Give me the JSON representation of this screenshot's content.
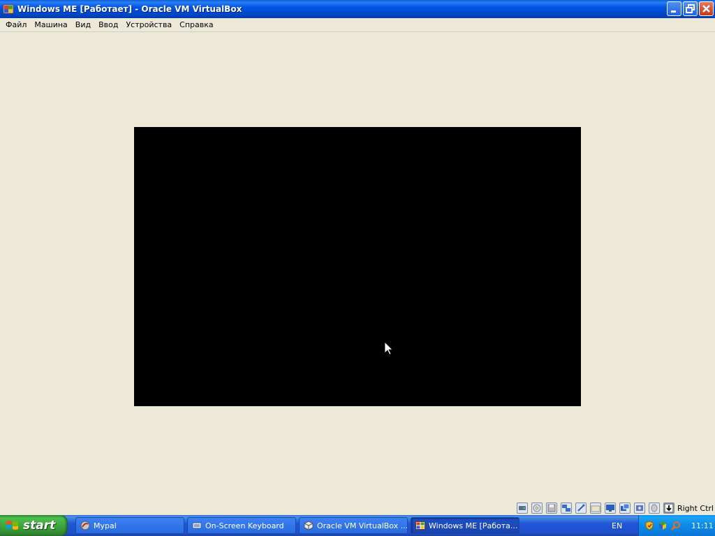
{
  "window": {
    "title": "Windows ME [Работает] - Oracle VM VirtualBox"
  },
  "menu": {
    "items": [
      "Файл",
      "Машина",
      "Вид",
      "Ввод",
      "Устройства",
      "Справка"
    ]
  },
  "vm_status": {
    "icons": [
      "hard-disk-icon",
      "cd-rom-icon",
      "floppy-icon",
      "network-icon",
      "usb-icon",
      "shared-folders-icon",
      "display-icon",
      "seamless-icon",
      "video-capture-icon",
      "mouse-integration-icon",
      "host-key-arrow-icon"
    ],
    "host_key": "Right Ctrl"
  },
  "taskbar": {
    "start_label": "start",
    "tasks": [
      {
        "label": "Mypal",
        "icon": "mypal-icon"
      },
      {
        "label": "On-Screen Keyboard",
        "icon": "keyboard-icon"
      },
      {
        "label": "Oracle VM VirtualBox ...",
        "icon": "virtualbox-icon"
      },
      {
        "label": "Windows ME [Работа...",
        "icon": "vm-window-icon",
        "active": true
      }
    ],
    "language": "EN",
    "clock": "11:11"
  },
  "colors": {
    "desktop_bg": "#ece9d8",
    "titlebar": "#0054e3",
    "vm_screen": "#000000",
    "taskbar": "#245edb",
    "start_button": "#3c9a3c"
  }
}
